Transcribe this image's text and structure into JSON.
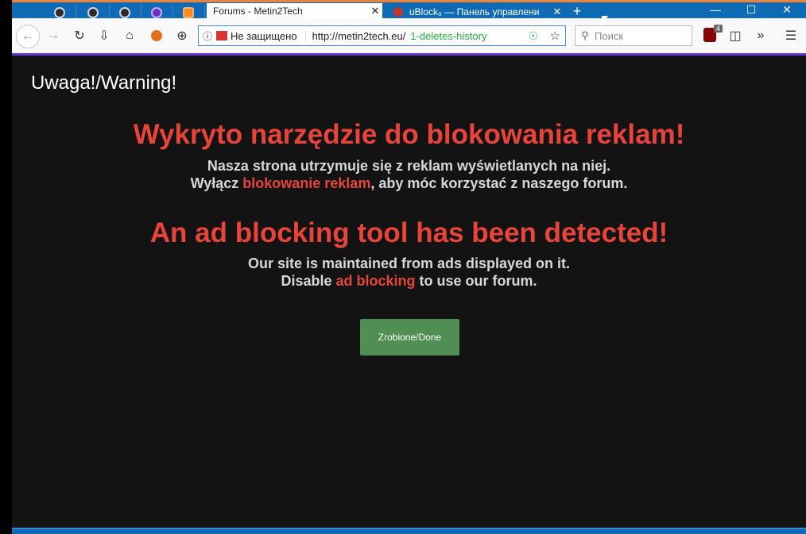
{
  "browser": {
    "tabs": [
      {
        "title": "Forums - Metin2Tech",
        "active": true
      },
      {
        "title": "uBlock₀ — Панель управлени",
        "active": false
      }
    ],
    "new_tab_label": "+",
    "tab_close": "✕",
    "window_controls": {
      "minimize": "—",
      "maximize": "☐",
      "close": "✕"
    },
    "url": {
      "info_label": "ⓘ",
      "security": "Не защищено",
      "host": "http://metin2tech.eu/",
      "path": "1-deletes-history"
    },
    "search_placeholder": "Поиск",
    "ublock_badge": "4",
    "icons": [
      "back-icon",
      "forward-icon",
      "reload-icon",
      "download-icon",
      "home-icon",
      "addon-icon",
      "plus-circle-icon",
      "star-icon",
      "sidebar-icon",
      "overflow-icon",
      "menu-icon"
    ]
  },
  "page": {
    "warning_heading": "Uwaga!/Warning!",
    "pl": {
      "title": "Wykryto narzędzie do blokowania reklam!",
      "line1": "Nasza strona utrzymuje się z reklam wyświetlanych na niej.",
      "line2_pre": "Wyłącz ",
      "line2_hl": "blokowanie reklam",
      "line2_post": ", aby móc korzystać z naszego forum."
    },
    "en": {
      "title": "An ad blocking tool has been detected!",
      "line1": "Our site is maintained from ads displayed on it.",
      "line2_pre": "Disable ",
      "line2_hl": "ad blocking",
      "line2_post": " to use our forum."
    },
    "done_button": "Zrobione/Done"
  },
  "colors": {
    "accent_red": "#e8443a",
    "button_green": "#4f8f54",
    "bg_dark": "#131313"
  }
}
